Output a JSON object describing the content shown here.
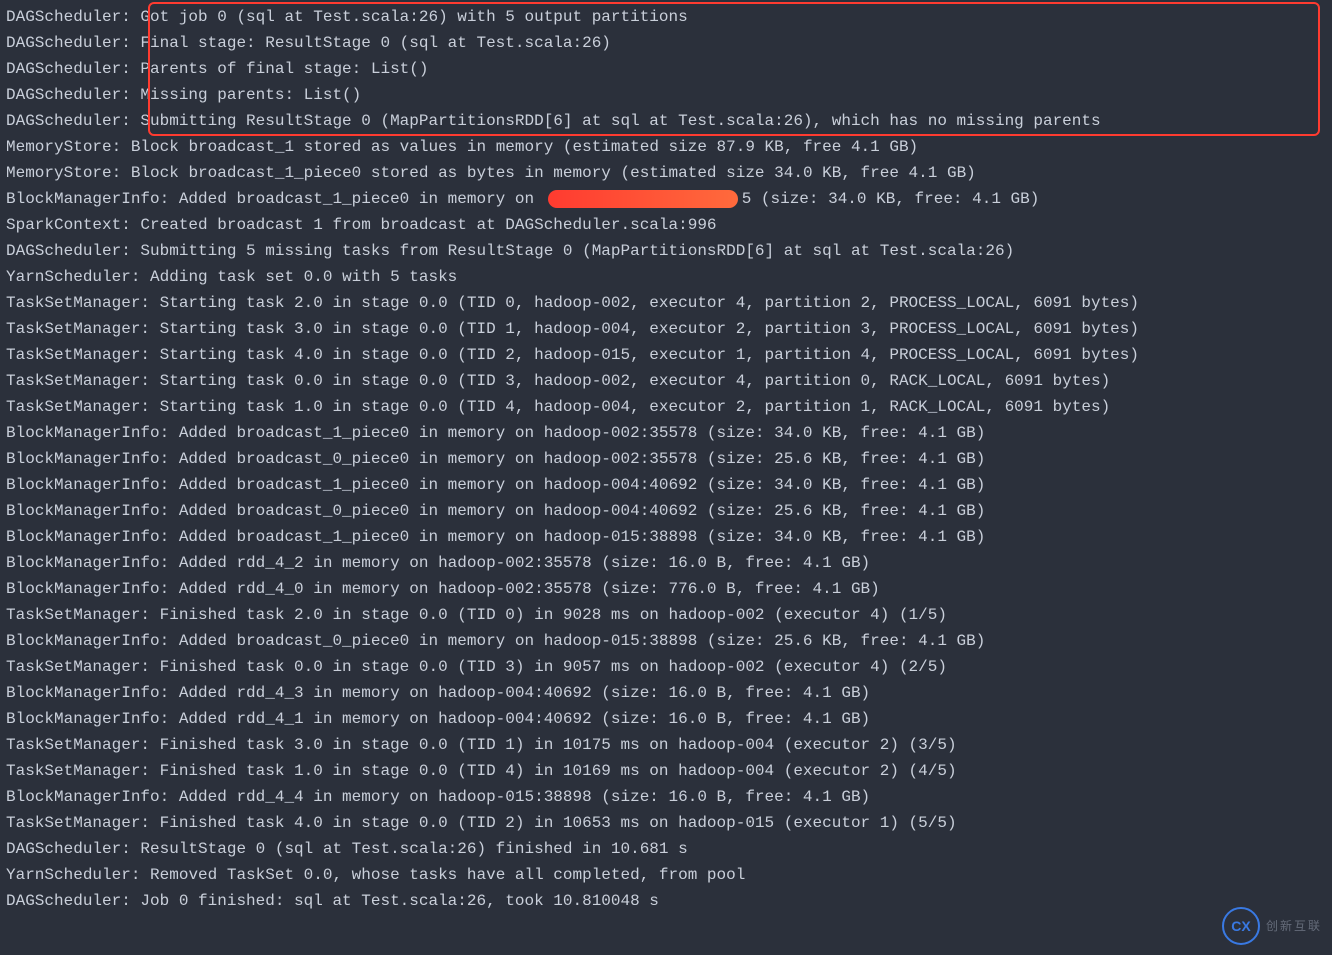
{
  "lines": [
    {
      "prefix": "DAGScheduler: ",
      "msg": "Got job 0 (sql at Test.scala:26) with 5 output partitions"
    },
    {
      "prefix": "DAGScheduler: ",
      "msg": "Final stage: ResultStage 0 (sql at Test.scala:26)"
    },
    {
      "prefix": "DAGScheduler: ",
      "msg": "Parents of final stage: List()"
    },
    {
      "prefix": "DAGScheduler: ",
      "msg": "Missing parents: List()"
    },
    {
      "prefix": "DAGScheduler: ",
      "msg": "Submitting ResultStage 0 (MapPartitionsRDD[6] at sql at Test.scala:26), which has no missing parents"
    },
    {
      "prefix": "MemoryStore: ",
      "msg": "Block broadcast_1 stored as values in memory (estimated size 87.9 KB, free 4.1 GB)"
    },
    {
      "prefix": "MemoryStore: ",
      "msg": "Block broadcast_1_piece0 stored as bytes in memory (estimated size 34.0 KB, free 4.1 GB)"
    },
    {
      "prefix": "BlockManagerInfo: ",
      "msg_before": "Added broadcast_1_piece0 in memory on ",
      "redacted": true,
      "msg_after": "5 (size: 34.0 KB, free: 4.1 GB)"
    },
    {
      "prefix": "SparkContext: ",
      "msg": "Created broadcast 1 from broadcast at DAGScheduler.scala:996"
    },
    {
      "prefix": "DAGScheduler: ",
      "msg": "Submitting 5 missing tasks from ResultStage 0 (MapPartitionsRDD[6] at sql at Test.scala:26)"
    },
    {
      "prefix": "YarnScheduler: ",
      "msg": "Adding task set 0.0 with 5 tasks"
    },
    {
      "prefix": "TaskSetManager: ",
      "msg": "Starting task 2.0 in stage 0.0 (TID 0, hadoop-002, executor 4, partition 2, PROCESS_LOCAL, 6091 bytes)"
    },
    {
      "prefix": "TaskSetManager: ",
      "msg": "Starting task 3.0 in stage 0.0 (TID 1, hadoop-004, executor 2, partition 3, PROCESS_LOCAL, 6091 bytes)"
    },
    {
      "prefix": "TaskSetManager: ",
      "msg": "Starting task 4.0 in stage 0.0 (TID 2, hadoop-015, executor 1, partition 4, PROCESS_LOCAL, 6091 bytes)"
    },
    {
      "prefix": "TaskSetManager: ",
      "msg": "Starting task 0.0 in stage 0.0 (TID 3, hadoop-002, executor 4, partition 0, RACK_LOCAL, 6091 bytes)"
    },
    {
      "prefix": "TaskSetManager: ",
      "msg": "Starting task 1.0 in stage 0.0 (TID 4, hadoop-004, executor 2, partition 1, RACK_LOCAL, 6091 bytes)"
    },
    {
      "prefix": "BlockManagerInfo: ",
      "msg": "Added broadcast_1_piece0 in memory on hadoop-002:35578 (size: 34.0 KB, free: 4.1 GB)"
    },
    {
      "prefix": "BlockManagerInfo: ",
      "msg": "Added broadcast_0_piece0 in memory on hadoop-002:35578 (size: 25.6 KB, free: 4.1 GB)"
    },
    {
      "prefix": "BlockManagerInfo: ",
      "msg": "Added broadcast_1_piece0 in memory on hadoop-004:40692 (size: 34.0 KB, free: 4.1 GB)"
    },
    {
      "prefix": "BlockManagerInfo: ",
      "msg": "Added broadcast_0_piece0 in memory on hadoop-004:40692 (size: 25.6 KB, free: 4.1 GB)"
    },
    {
      "prefix": "BlockManagerInfo: ",
      "msg": "Added broadcast_1_piece0 in memory on hadoop-015:38898 (size: 34.0 KB, free: 4.1 GB)"
    },
    {
      "prefix": "BlockManagerInfo: ",
      "msg": "Added rdd_4_2 in memory on hadoop-002:35578 (size: 16.0 B, free: 4.1 GB)"
    },
    {
      "prefix": "BlockManagerInfo: ",
      "msg": "Added rdd_4_0 in memory on hadoop-002:35578 (size: 776.0 B, free: 4.1 GB)"
    },
    {
      "prefix": "TaskSetManager: ",
      "msg": "Finished task 2.0 in stage 0.0 (TID 0) in 9028 ms on hadoop-002 (executor 4) (1/5)"
    },
    {
      "prefix": "BlockManagerInfo: ",
      "msg": "Added broadcast_0_piece0 in memory on hadoop-015:38898 (size: 25.6 KB, free: 4.1 GB)"
    },
    {
      "prefix": "TaskSetManager: ",
      "msg": "Finished task 0.0 in stage 0.0 (TID 3) in 9057 ms on hadoop-002 (executor 4) (2/5)"
    },
    {
      "prefix": "BlockManagerInfo: ",
      "msg": "Added rdd_4_3 in memory on hadoop-004:40692 (size: 16.0 B, free: 4.1 GB)"
    },
    {
      "prefix": "BlockManagerInfo: ",
      "msg": "Added rdd_4_1 in memory on hadoop-004:40692 (size: 16.0 B, free: 4.1 GB)"
    },
    {
      "prefix": "TaskSetManager: ",
      "msg": "Finished task 3.0 in stage 0.0 (TID 1) in 10175 ms on hadoop-004 (executor 2) (3/5)"
    },
    {
      "prefix": "TaskSetManager: ",
      "msg": "Finished task 1.0 in stage 0.0 (TID 4) in 10169 ms on hadoop-004 (executor 2) (4/5)"
    },
    {
      "prefix": "BlockManagerInfo: ",
      "msg": "Added rdd_4_4 in memory on hadoop-015:38898 (size: 16.0 B, free: 4.1 GB)"
    },
    {
      "prefix": "TaskSetManager: ",
      "msg": "Finished task 4.0 in stage 0.0 (TID 2) in 10653 ms on hadoop-015 (executor 1) (5/5)"
    },
    {
      "prefix": "DAGScheduler: ",
      "msg": "ResultStage 0 (sql at Test.scala:26) finished in 10.681 s"
    },
    {
      "prefix": "YarnScheduler: ",
      "msg": "Removed TaskSet 0.0, whose tasks have all completed, from pool"
    },
    {
      "prefix": "DAGScheduler: ",
      "msg": "Job 0 finished: sql at Test.scala:26, took 10.810048 s"
    }
  ],
  "watermark": {
    "logo": "CX",
    "text": "创新互联"
  }
}
